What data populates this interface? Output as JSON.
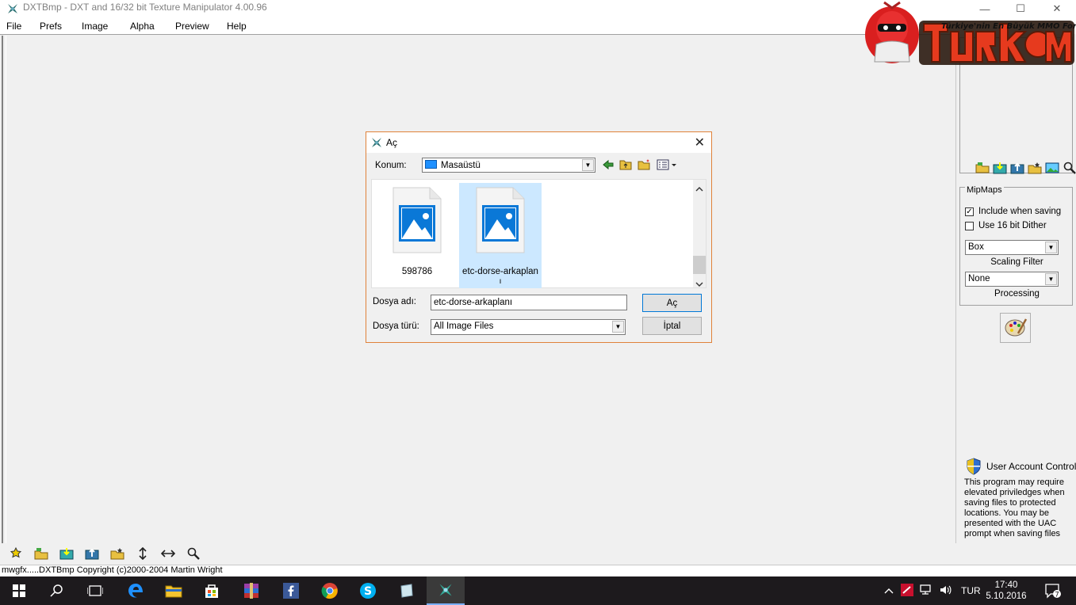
{
  "window": {
    "title": "DXTBmp - DXT and 16/32 bit Texture Manipulator  4.00.96",
    "controls": {
      "minimize": "—",
      "maximize": "☐",
      "close": "✕"
    }
  },
  "menu": {
    "items": [
      "File",
      "Prefs",
      "Image",
      "Alpha",
      "Preview",
      "Help"
    ]
  },
  "logo": {
    "tagline": "Türkiye'nin En Büyük MMO Forumu",
    "wordmark": "TURKMMO"
  },
  "right_panel": {
    "mipmaps_title": "MipMaps",
    "include_when_saving": "Include when saving",
    "include_checked": true,
    "use_16bit_dither": "Use 16 bit Dither",
    "dither_checked": false,
    "scaling_value": "Box",
    "scaling_label": "Scaling Filter",
    "processing_value": "None",
    "processing_label": "Processing",
    "uac_title": "User Account Control",
    "uac_text": "This program may require elevated priviledges when saving files to protected locations. You may be presented with the UAC prompt when saving files"
  },
  "status": {
    "text": "mwgfx.....DXTBmp Copyright (c)2000-2004 Martin Wright"
  },
  "dialog": {
    "title": "Aç",
    "location_label": "Konum:",
    "location_value": "Masaüstü",
    "files": [
      {
        "name": "598786",
        "selected": false
      },
      {
        "name": "etc-dorse-arkaplan",
        "name_extra": "ı",
        "selected": true
      }
    ],
    "filename_label": "Dosya adı:",
    "filename_value": "etc-dorse-arkaplanı",
    "filetype_label": "Dosya türü:",
    "filetype_value": "All Image Files",
    "open_button": "Aç",
    "cancel_button": "İptal"
  },
  "taskbar": {
    "language": "TUR",
    "time": "17:40",
    "date": "5.10.2016",
    "notification_count": "7"
  },
  "colors": {
    "accent": "#0078d7",
    "dialog_border": "#e0823a",
    "selection": "#cce8ff",
    "taskbar": "#1d1a1d"
  }
}
